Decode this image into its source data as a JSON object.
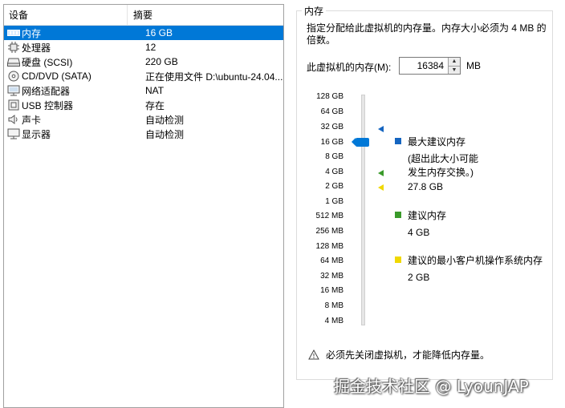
{
  "device_list": {
    "headers": {
      "device": "设备",
      "summary": "摘要"
    },
    "rows": [
      {
        "icon": "memory-icon",
        "name": "内存",
        "summary": "16 GB",
        "selected": true
      },
      {
        "icon": "processor-icon",
        "name": "处理器",
        "summary": "12",
        "selected": false
      },
      {
        "icon": "hard-disk-icon",
        "name": "硬盘 (SCSI)",
        "summary": "220 GB",
        "selected": false
      },
      {
        "icon": "cd-dvd-icon",
        "name": "CD/DVD (SATA)",
        "summary": "正在使用文件 D:\\ubuntu-24.04...",
        "selected": false
      },
      {
        "icon": "network-adapter-icon",
        "name": "网络适配器",
        "summary": "NAT",
        "selected": false
      },
      {
        "icon": "usb-controller-icon",
        "name": "USB 控制器",
        "summary": "存在",
        "selected": false
      },
      {
        "icon": "sound-card-icon",
        "name": "声卡",
        "summary": "自动检测",
        "selected": false
      },
      {
        "icon": "display-icon",
        "name": "显示器",
        "summary": "自动检测",
        "selected": false
      }
    ]
  },
  "memory": {
    "group_title": "内存",
    "description": "指定分配给此虚拟机的内存量。内存大小必须为 4 MB 的倍数。",
    "input_label": "此虚拟机的内存(M):",
    "value": "16384",
    "unit": "MB",
    "scale_labels": [
      "128 GB",
      "64 GB",
      "32 GB",
      "16 GB",
      "8 GB",
      "4 GB",
      "2 GB",
      "1 GB",
      "512 MB",
      "256 MB",
      "128 MB",
      "64 MB",
      "32 MB",
      "16 MB",
      "8 MB",
      "4 MB"
    ],
    "selected_scale_value": "16 GB",
    "legend": {
      "max": {
        "title": "最大建议内存",
        "note": "(超出此大小可能发生内存交换。)",
        "value": "27.8 GB",
        "color": "#1565c0"
      },
      "recommended": {
        "title": "建议内存",
        "value": "4 GB",
        "color": "#3a9a2a"
      },
      "min": {
        "title": "建议的最小客户机操作系统内存",
        "value": "2 GB",
        "color": "#f0d800"
      }
    },
    "warning": "必须先关闭虚拟机，才能降低内存量。"
  },
  "watermark": "掘金技术社区 @ LyounJAP"
}
